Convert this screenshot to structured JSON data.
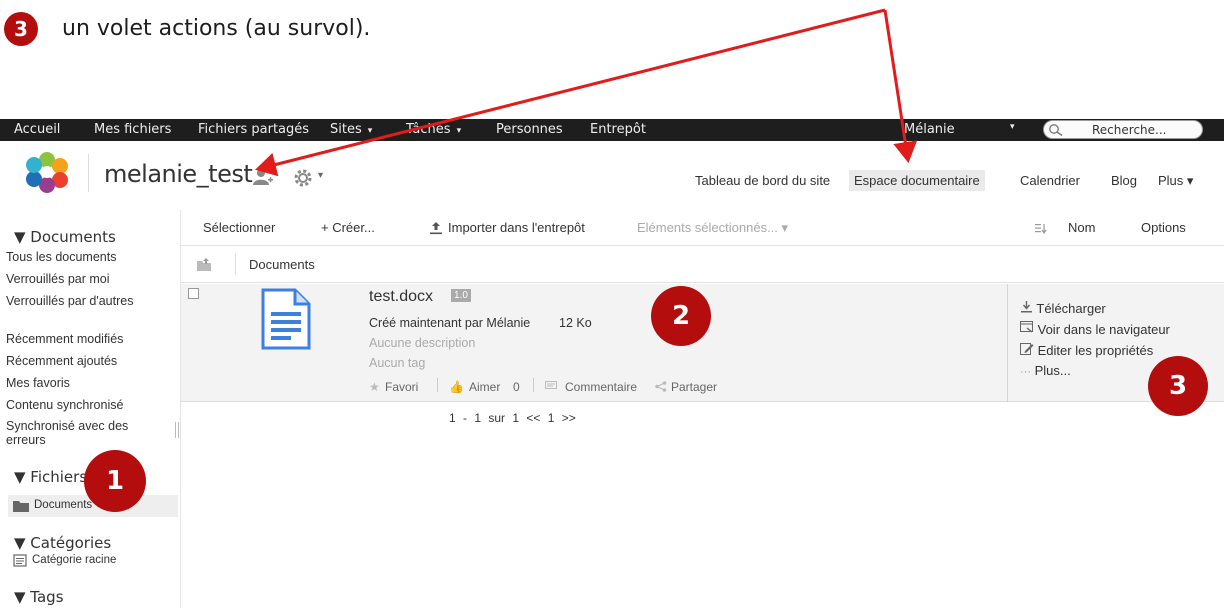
{
  "annotation": {
    "number": "3",
    "text": "un volet actions (au survol).",
    "badges": [
      "1",
      "2",
      "3"
    ],
    "color": "#b40d0d"
  },
  "topnav": {
    "items": [
      {
        "label": "Accueil"
      },
      {
        "label": "Mes fichiers"
      },
      {
        "label": "Fichiers partagés"
      },
      {
        "label": "Sites",
        "caret": "▾"
      },
      {
        "label": "Tâches",
        "caret": "▾"
      },
      {
        "label": "Personnes"
      },
      {
        "label": "Entrepôt"
      }
    ],
    "user": "Mélanie",
    "user_caret": "▾",
    "search_placeholder": "Recherche..."
  },
  "site": {
    "title": "melanie_test",
    "gear_caret": "▾",
    "nav": [
      {
        "label": "Tableau de bord du site"
      },
      {
        "label": "Espace documentaire",
        "active": true
      },
      {
        "label": "Calendrier"
      },
      {
        "label": "Blog"
      },
      {
        "label": "Plus ▾"
      }
    ]
  },
  "sidebar": {
    "documents_header": "▼ Documents",
    "documents_items": [
      "Tous les documents",
      "Verrouillés par moi",
      "Verrouillés par d'autres",
      "Récemment modifiés",
      "Récemment ajoutés",
      "Mes favoris",
      "Contenu synchronisé",
      "Synchronisé avec des erreurs"
    ],
    "fichiers_header": "▼ Fichiers",
    "fichiers_item": "Documents",
    "categories_header": "▼ Catégories",
    "categories_item": "Catégorie racine",
    "tags_header": "▼ Tags"
  },
  "toolbar": {
    "select": "Sélectionner",
    "create": "+ Créer...",
    "upload": "Importer dans l'entrepôt",
    "selected_items": "Eléments sélectionnés... ▾",
    "sort": "Nom",
    "options": "Options"
  },
  "breadcrumb": {
    "current": "Documents"
  },
  "document": {
    "name": "test.docx",
    "version": "1.0",
    "created": "Créé maintenant par Mélanie",
    "size": "12 Ko",
    "description": "Aucune description",
    "tags": "Aucun tag",
    "favorite": "Favori",
    "like": "Aimer",
    "like_count": "0",
    "comment": "Commentaire",
    "share": "Partager"
  },
  "actions": [
    "Télécharger",
    "Voir dans le navigateur",
    "Editer les propriétés",
    "Plus..."
  ],
  "pagination": {
    "text": "1 - 1 sur 1",
    "prev": "<<",
    "page": "1",
    "next": ">>"
  }
}
